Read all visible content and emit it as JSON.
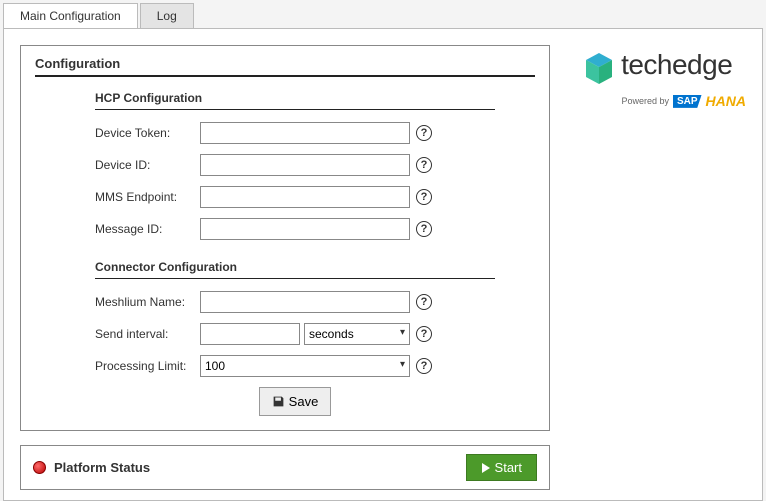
{
  "tabs": {
    "main": "Main Configuration",
    "log": "Log"
  },
  "config": {
    "title": "Configuration",
    "hcp": {
      "heading": "HCP Configuration",
      "device_token_label": "Device Token:",
      "device_token_value": "",
      "device_id_label": "Device ID:",
      "device_id_value": "",
      "mms_endpoint_label": "MMS Endpoint:",
      "mms_endpoint_value": "",
      "message_id_label": "Message ID:",
      "message_id_value": ""
    },
    "connector": {
      "heading": "Connector Configuration",
      "meshlium_name_label": "Meshlium Name:",
      "meshlium_name_value": "",
      "send_interval_label": "Send interval:",
      "send_interval_value": "",
      "send_interval_unit": "seconds",
      "processing_limit_label": "Processing Limit:",
      "processing_limit_value": "100"
    },
    "save_label": "Save"
  },
  "status": {
    "label": "Platform Status",
    "color": "red",
    "start_label": "Start"
  },
  "brand": {
    "name": "techedge",
    "powered_by": "Powered by",
    "sap": "SAP",
    "hana": "HANA"
  },
  "help": "?"
}
